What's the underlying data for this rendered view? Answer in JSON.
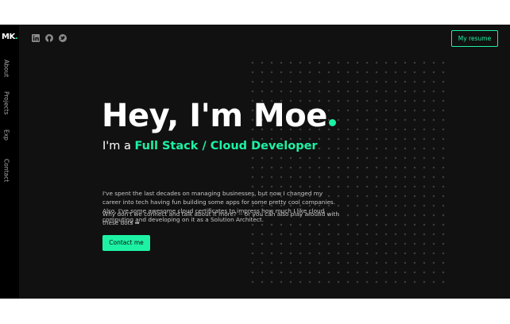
{
  "brand": {
    "logo_text": "MK",
    "logo_dot": "."
  },
  "nav": {
    "items": [
      "About",
      "Projects",
      "Exp",
      "Contact"
    ]
  },
  "social": {
    "icons": [
      "linkedin-icon",
      "github-icon",
      "twitter-icon"
    ]
  },
  "header": {
    "resume_label": "My resume"
  },
  "hero": {
    "title": "Hey, I'm Moe",
    "subtitle_prefix": "I'm a ",
    "subtitle_role": "Full Stack / Cloud Developer",
    "paragraph1": "I've spent the last decades on managing businesses, but now I changed my career into tech having fun building some apps for some pretty cool companies. Also, I've some awesome cloud certificates to impress how much I like cloud computing and developing on it as a Solution Architect.",
    "paragraph2": "Why don't we connect and talk about it more? -- or you can also play around with these dots ➡",
    "cta_label": "Contact me"
  },
  "colors": {
    "accent": "#1df2a4",
    "background": "#111111",
    "sidebar": "#000000",
    "text": "#ffffff",
    "muted": "#c8c8c8"
  }
}
